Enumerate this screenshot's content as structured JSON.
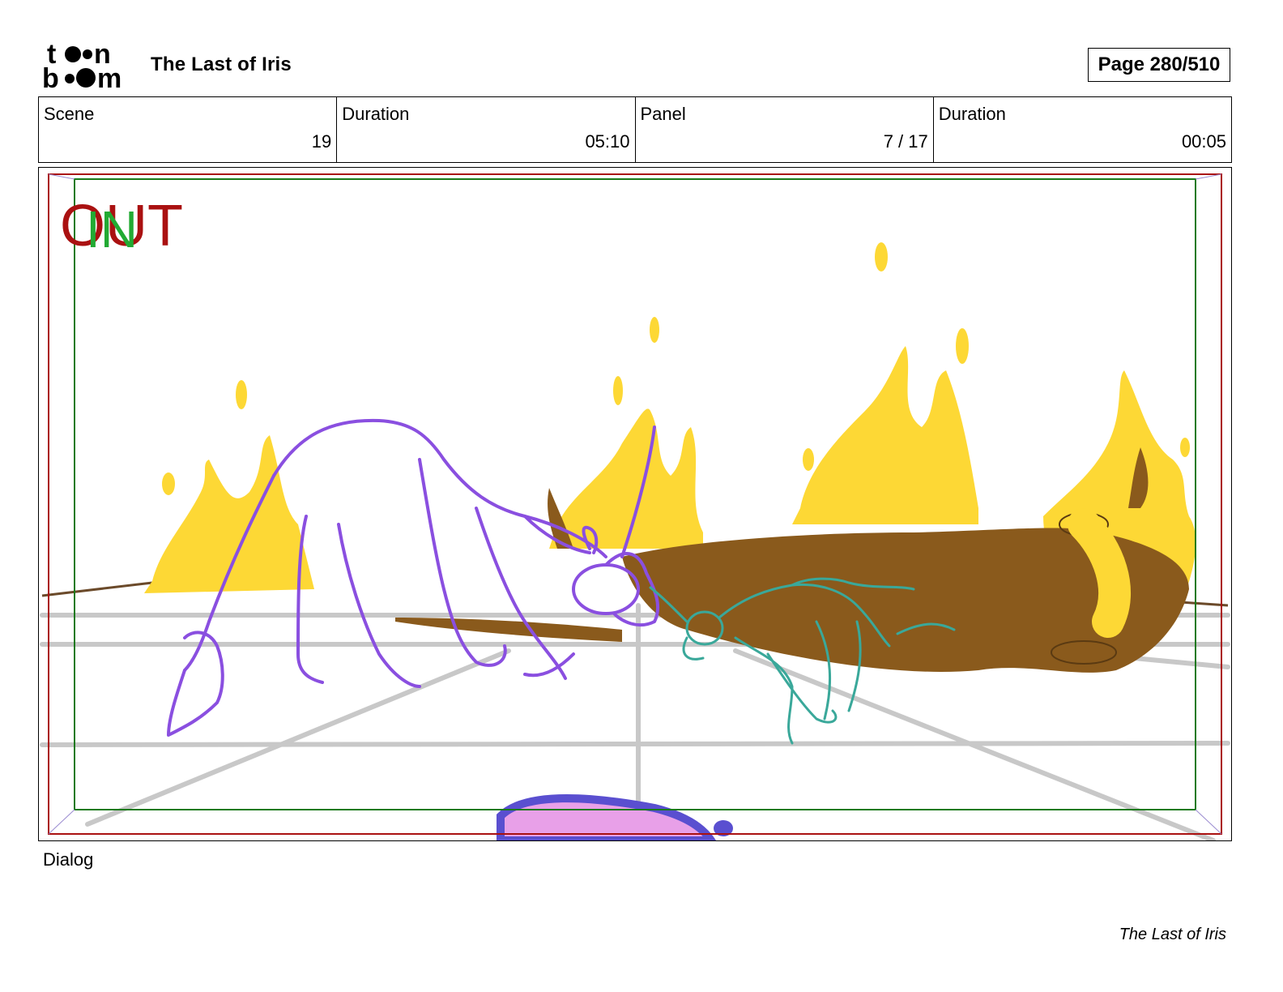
{
  "header": {
    "logo_text": "toon boom",
    "project_title": "The Last of Iris",
    "page_label": "Page 280/510"
  },
  "info": {
    "scene_label": "Scene",
    "scene_value": "19",
    "scene_duration_label": "Duration",
    "scene_duration_value": "05:10",
    "panel_label": "Panel",
    "panel_value": "7 / 17",
    "panel_duration_label": "Duration",
    "panel_duration_value": "00:05"
  },
  "panel": {
    "out_label": "OUT",
    "in_label": "IN",
    "colors": {
      "out_frame": "#aa1111",
      "in_frame": "#1a7a1a",
      "in_text": "#22aa33",
      "fire": "#fdd835",
      "log": "#8a5a1c",
      "unicorn_adult": "#8a4fe0",
      "unicorn_foal": "#3aa89a",
      "guide_lines": "#c8c8c8"
    }
  },
  "dialog_label": "Dialog",
  "footer": {
    "title": "The Last of Iris"
  }
}
